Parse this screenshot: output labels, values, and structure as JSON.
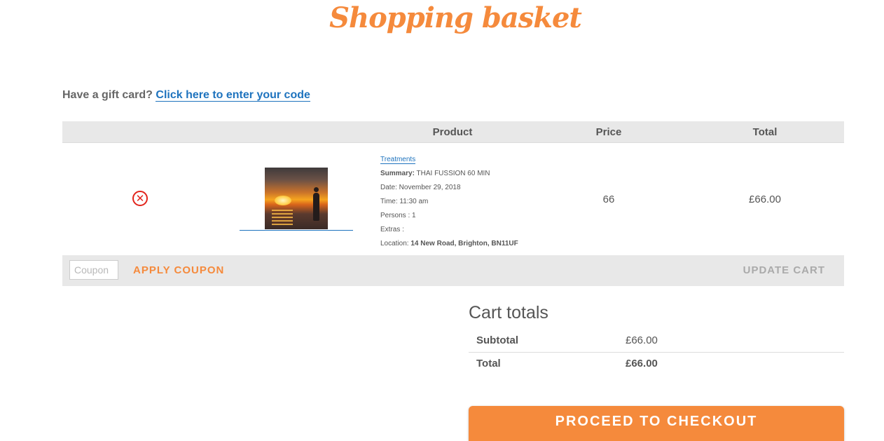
{
  "page": {
    "title": "Shopping basket"
  },
  "gift_card": {
    "prompt": "Have a gift card?",
    "link": "Click here to enter your code"
  },
  "table": {
    "headers": [
      "Product",
      "Price",
      "Total"
    ]
  },
  "cart_item": {
    "category": "Treatments",
    "summary_label": "Summary:",
    "summary_value": "THAI FUSSION 60 MIN",
    "date": "Date: November 29, 2018",
    "time": "Time: 11:30 am",
    "persons": "Persons : 1",
    "extras": "Extras :",
    "location_label": "Location:",
    "location_value": "14 New Road, Brighton, BN11UF",
    "price": "66",
    "total": "£66.00",
    "remove_icon": "x-circle-icon"
  },
  "actions": {
    "coupon_placeholder": "Coupon",
    "coupon_value": "",
    "apply_label": "APPLY COUPON",
    "update_label": "UPDATE CART"
  },
  "cart_totals": {
    "title": "Cart totals",
    "subtotal_label": "Subtotal",
    "subtotal_value": "£66.00",
    "total_label": "Total",
    "total_value": "£66.00",
    "checkout_label": "PROCEED TO CHECKOUT"
  },
  "colors": {
    "accent": "#f58a3c",
    "link": "#1e73be",
    "remove": "#e2241b",
    "header_bg": "#e8e8e8"
  }
}
